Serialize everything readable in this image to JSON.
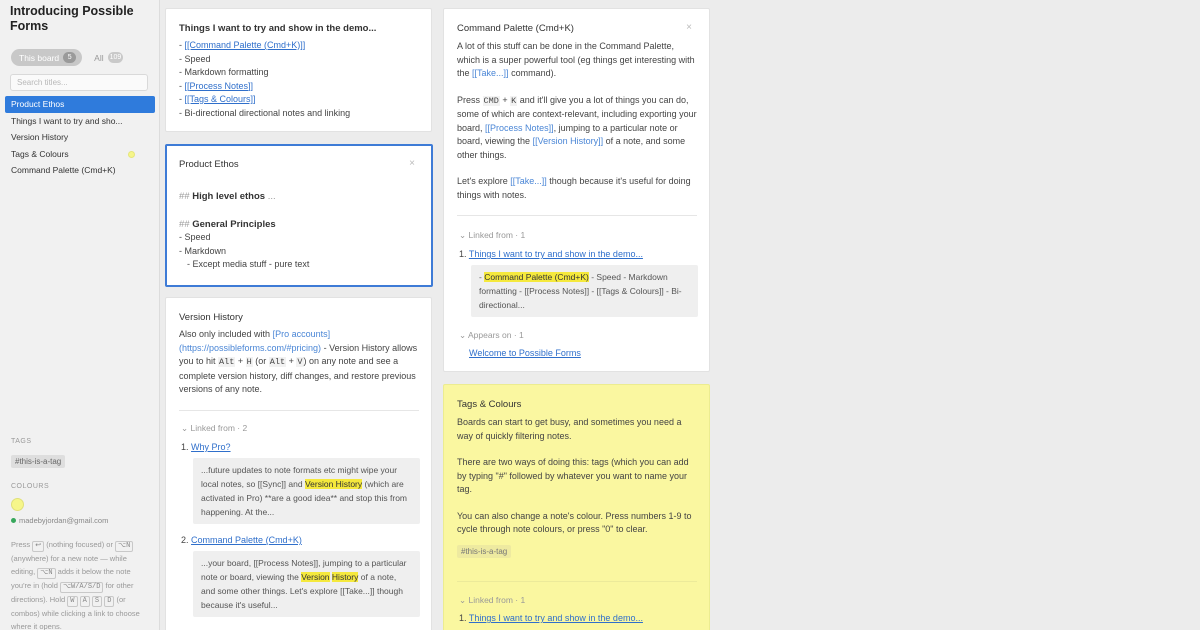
{
  "sidebar": {
    "title": "Introducing Possible Forms",
    "this_board": "This board",
    "this_board_count": "5",
    "all": "All",
    "all_count": "109",
    "search_placeholder": "Search titles...",
    "items": [
      {
        "label": "Product Ethos"
      },
      {
        "label": "Things I want to try and sho..."
      },
      {
        "label": "Version History"
      },
      {
        "label": "Tags & Colours"
      },
      {
        "label": "Command Palette (Cmd+K)"
      }
    ],
    "tags_label": "TAGS",
    "tag": "#this-is-a-tag",
    "colours_label": "COLOURS",
    "email": "madebyjordan@gmail.com",
    "help": {
      "p1": "Press",
      "k1": "↩",
      "p2": "(nothing focused) or",
      "k2": "⌥N",
      "p3": "(anywhere) for a new note — while editing,",
      "k3": "⌥N",
      "p4": "adds it below the note you're in (hold",
      "k4": "⌥W/A/S/D",
      "p5": "for other directions). Hold",
      "k5": "W",
      "k6": "A",
      "k7": "S",
      "k8": "D",
      "p6": "(or combos) while clicking a link to choose where it opens."
    }
  },
  "things": {
    "title": "Things I want to try and show in the demo...",
    "l1": "[[Command Palette (Cmd+K)]]",
    "l2": "Speed",
    "l3": "Markdown formatting",
    "l4": "[[Process Notes]]",
    "l5": "[[Tags & Colours]]",
    "l6": "Bi-directional directional notes and linking"
  },
  "ethos": {
    "title": "Product Ethos",
    "close": "×",
    "h1": "High level ethos",
    "h1_more": "...",
    "h2": "General Principles",
    "l1": "Speed",
    "l2": "Markdown",
    "l3": "Except media stuff - pure text"
  },
  "version": {
    "title": "Version History",
    "t1": "Also only included with",
    "pro": "[Pro accounts]",
    "url": "(https://possibleforms.com/#pricing)",
    "t2": "- Version History allows you to hit",
    "alt": "Alt",
    "plus": "+",
    "h": "H",
    "or": "(or",
    "v": "V",
    "t3": ") on any note and see a complete version history, diff changes, and restore previous versions of any note.",
    "linked_from": "Linked from · 2",
    "item1_num": "1.",
    "item1": "Why Pro?",
    "q1a": "...future updates to note formats etc might wipe your local notes, so [[Sync]] and",
    "q1_hl": "Version History",
    "q1b": "(which are activated in Pro) **are a good idea** and stop this from happening. At the...",
    "item2_num": "2.",
    "item2": "Command Palette (Cmd+K)",
    "q2a": "...your board, [[Process Notes]], jumping to a particular note or board, viewing the",
    "q2_hl1": "Version",
    "q2_hl2": "History",
    "q2b": "of a note, and some other things. Let's explore [[Take...]] though because it's useful..."
  },
  "command": {
    "title": "Command Palette (Cmd+K)",
    "close": "×",
    "p1a": "A lot of this stuff can be done in the Command Palette, which is a super powerful tool (eg things get interesting with the",
    "p1_link": "[[Take...]]",
    "p1b": "command).",
    "p2a": "Press",
    "cmd": "CMD",
    "k": "K",
    "p2b": "and it'll give you a lot of things you can do, some of which are context-relevant, including exporting your board,",
    "p2_link1": "[[Process Notes]]",
    "p2c": ", jumping to a particular note or board, viewing the",
    "p2_link2": "[[Version History]]",
    "p2d": "of a note, and some other things.",
    "p3a": "Let's explore",
    "p3_link": "[[Take...]]",
    "p3b": "though because it's useful for doing things with notes.",
    "linked_from": "Linked from · 1",
    "item1_num": "1.",
    "item1": "Things I want to try and show in the demo...",
    "q_hl": "Command Palette (Cmd+K)",
    "q_rest": "- Speed - Markdown formatting - [[Process Notes]] - [[Tags & Colours]] - Bi-directional...",
    "appears_on": "Appears on · 1",
    "appears_item": "Welcome to Possible Forms"
  },
  "tags": {
    "title": "Tags & Colours",
    "p1": "Boards can start to get busy, and sometimes you need a way of quickly filtering notes.",
    "p2": "There are two ways of doing this: tags (which you can add by typing \"#\" followed by whatever you want to name your tag.",
    "p3": "You can also change a note's colour. Press numbers 1-9 to cycle through note colours, or press \"0\" to clear.",
    "tag": "#this-is-a-tag",
    "linked_from": "Linked from · 1",
    "item1_num": "1.",
    "item1": "Things I want to try and show in the demo..."
  },
  "colors": {
    "accent": "#2f7bdc",
    "highlight": "#f5e93d",
    "yellow_note": "#faf7a0"
  }
}
